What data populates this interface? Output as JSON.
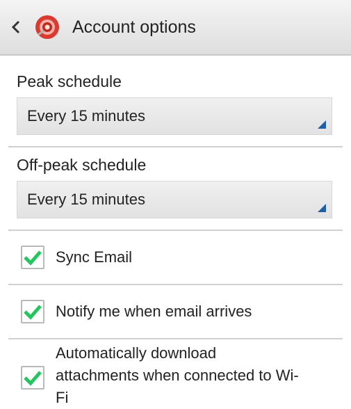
{
  "header": {
    "back_icon": "chevron-left-icon",
    "app_icon": "email-app-icon",
    "title": "Account options"
  },
  "peak": {
    "label": "Peak schedule",
    "value": "Every 15 minutes"
  },
  "offpeak": {
    "label": "Off-peak schedule",
    "value": "Every 15 minutes"
  },
  "options": [
    {
      "label": "Sync Email",
      "checked": true
    },
    {
      "label": "Notify me when email arrives",
      "checked": true
    },
    {
      "label_lines": [
        "Automatically download",
        "attachments when connected to Wi-",
        "Fi"
      ],
      "checked": true
    }
  ],
  "colors": {
    "check": "#22c55e",
    "accent_corner": "#1f5fa8"
  }
}
